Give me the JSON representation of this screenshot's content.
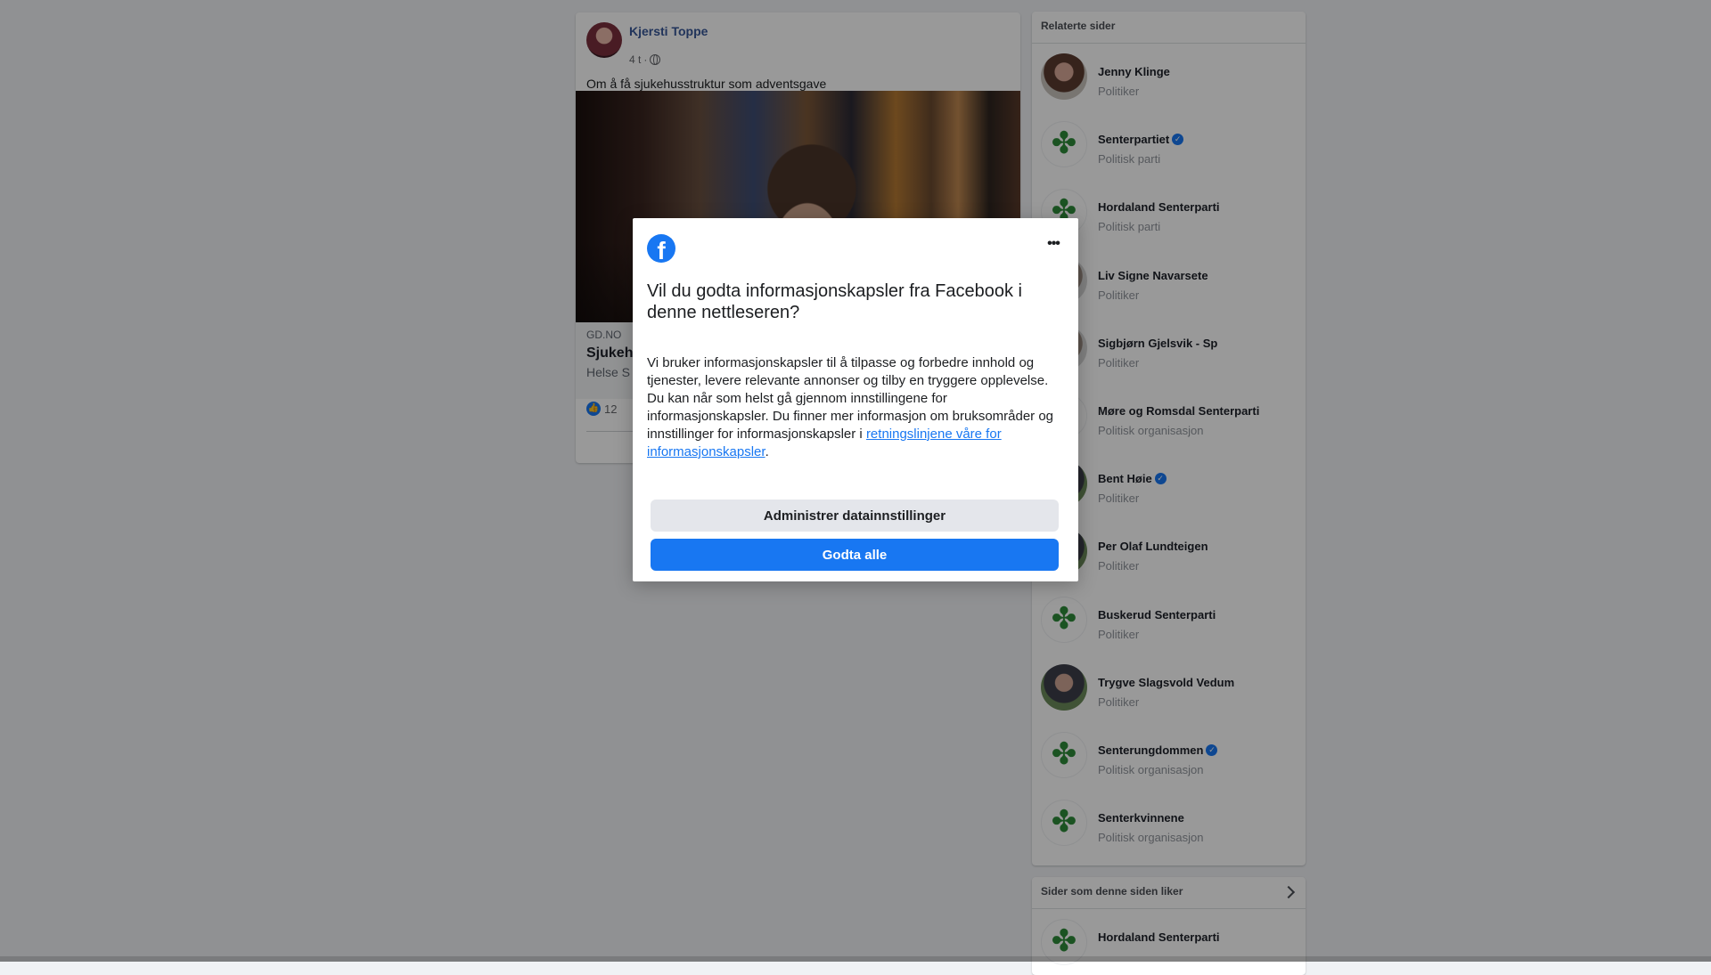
{
  "post": {
    "author": "Kjersti Toppe",
    "time": "4 t",
    "separator": "·",
    "text": "Om å få sjukehusstruktur som adventsgave",
    "link": {
      "domain": "GD.NO",
      "title": "Sjukeh",
      "description": "Helse S"
    },
    "reaction_count": "12"
  },
  "related": {
    "header": "Relaterte sider",
    "items": [
      {
        "name": "Jenny Klinge",
        "category": "Politiker",
        "verified": false
      },
      {
        "name": "Senterpartiet",
        "category": "Politisk parti",
        "verified": true
      },
      {
        "name": "Hordaland Senterparti",
        "category": "Politisk parti",
        "verified": false
      },
      {
        "name": "Liv Signe Navarsete",
        "category": "Politiker",
        "verified": false
      },
      {
        "name": "Sigbjørn Gjelsvik - Sp",
        "category": "Politiker",
        "verified": false
      },
      {
        "name": "Møre og Romsdal Senterparti",
        "category": "Politisk organisasjon",
        "verified": false
      },
      {
        "name": "Bent Høie",
        "category": "Politiker",
        "verified": true
      },
      {
        "name": "Per Olaf Lundteigen",
        "category": "Politiker",
        "verified": false
      },
      {
        "name": "Buskerud Senterparti",
        "category": "Politiker",
        "verified": false
      },
      {
        "name": "Trygve Slagsvold Vedum",
        "category": "Politiker",
        "verified": false
      },
      {
        "name": "Senterungdommen",
        "category": "Politisk organisasjon",
        "verified": true
      },
      {
        "name": "Senterkvinnene",
        "category": "Politisk organisasjon",
        "verified": false
      }
    ]
  },
  "likes": {
    "header": "Sider som denne siden liker",
    "items": [
      {
        "name": "Hordaland Senterparti"
      }
    ]
  },
  "dialog": {
    "logo_letter": "f",
    "more_label": "•••",
    "title": "Vil du godta informasjonskapsler fra Facebook i denne nettleseren?",
    "body": "Vi bruker informasjonskapsler til å tilpasse og forbedre innhold og tjenester, levere relevante annonser og tilby en tryggere opplevelse. Du kan når som helst gå gjennom innstillingene for informasjonskapsler. Du finner mer informasjon om bruksområder og innstillinger for informasjonskapsler i ",
    "link_text": "retningslinjene våre for informasjonskapsler",
    "body_end": ".",
    "manage_button": "Administrer datainnstillinger",
    "accept_button": "Godta alle"
  },
  "colors": {
    "brand": "#1877f2",
    "author_link": "#385898",
    "overlay": "rgba(0,0,0,0.4)"
  },
  "icons": {
    "logo": "facebook-icon",
    "privacy": "globe-icon",
    "reaction": "like-icon",
    "verified": "verified-badge-icon",
    "see_more": "chevron-right-icon"
  }
}
